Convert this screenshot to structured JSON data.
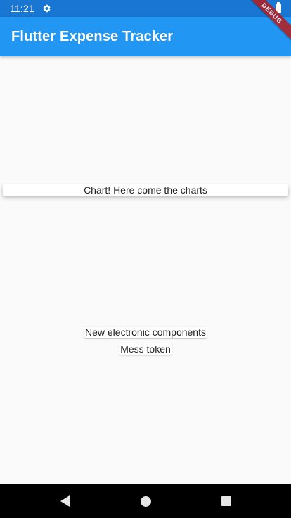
{
  "status_bar": {
    "time": "11:21",
    "icons": [
      "gear-icon",
      "battery-icon"
    ]
  },
  "app_bar": {
    "title": "Flutter Expense Tracker",
    "color": "#2196f3"
  },
  "debug_banner": {
    "label": "DEBUG",
    "color": "#b71c1c"
  },
  "chart_card": {
    "label": "Chart! Here come the charts"
  },
  "transactions": [
    {
      "title": "New electronic components"
    },
    {
      "title": "Mess token"
    }
  ],
  "nav_bar": {
    "icons": [
      "back-icon",
      "home-icon",
      "recents-icon"
    ]
  }
}
